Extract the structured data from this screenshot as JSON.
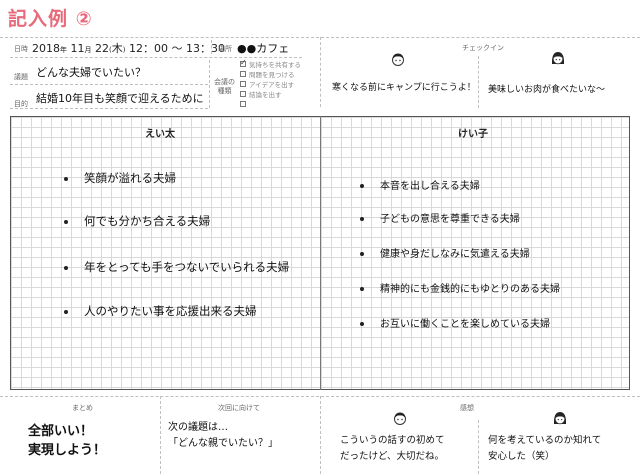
{
  "header": {
    "title": "記入例 ②"
  },
  "meta": {
    "date_label": "日時",
    "date": {
      "year": "2018",
      "nen": "年",
      "month": "11",
      "tsuki": "月",
      "day": "22",
      "ka": "(",
      "weekday": "木",
      "kb": ")",
      "start": "12：00",
      "sep": "～",
      "end": "13：30"
    },
    "place_label": "場所",
    "place": "●●カフェ",
    "agenda_label": "議題",
    "agenda": "どんな夫婦でいたい？",
    "purpose_label": "目的",
    "purpose": "結婚10年目も笑顔で迎えるために",
    "kind_label_1": "会議の",
    "kind_label_2": "種類",
    "kinds": [
      {
        "label": "気持ちを共有する",
        "checked": true
      },
      {
        "label": "問題を見つける",
        "checked": false
      },
      {
        "label": "アイデアを出す",
        "checked": false
      },
      {
        "label": "結論を出す",
        "checked": false
      },
      {
        "label": "",
        "checked": false
      }
    ]
  },
  "checkin": {
    "label": "チェックイン",
    "left": "寒くなる前にキャンプに行こうよ！",
    "right": "美味しいお肉が食べたいな～",
    "left_icon": "man-face-icon",
    "right_icon": "woman-face-icon"
  },
  "board": {
    "left_name": "えい太",
    "right_name": "けい子",
    "left_items": [
      "笑顔が溢れる夫婦",
      "何でも分かち合える夫婦",
      "年をとっても手をつないでいられる夫婦",
      "人のやりたい事を応援出来る夫婦"
    ],
    "right_items": [
      "本音を出し合える夫婦",
      "子どもの意思を尊重できる夫婦",
      "健康や身だしなみに気遣える夫婦",
      "精神的にも金銭的にもゆとりのある夫婦",
      "お互いに働くことを楽しめている夫婦"
    ]
  },
  "footer": {
    "summary_label": "まとめ",
    "summary_line1": "全部いい！",
    "summary_line2": "実現しよう！",
    "next_label": "次回に向けて",
    "next_line1": "次の議題は…",
    "next_line2": "「どんな親でいたい？」",
    "impression_label": "感想",
    "impression_left_line1": "こういうの話すの初めて",
    "impression_left_line2": "だったけど、大切だね。",
    "impression_right_line1": "何を考えているのか知れて",
    "impression_right_line2": "安心した（笑）"
  },
  "colors": {
    "title": "#e8697a",
    "grid_line": "#d9d9d9",
    "border": "#555555"
  }
}
